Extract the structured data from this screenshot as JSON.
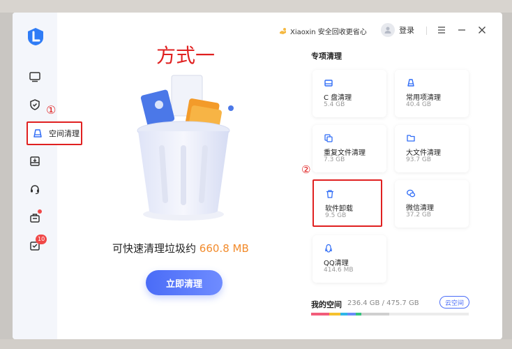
{
  "promo": {
    "text": "Xiaoxin 安全回收更省心"
  },
  "user": {
    "login": "登录"
  },
  "sidebar": {
    "active_label": "空间清理",
    "badge_count": "10"
  },
  "annotations": {
    "method_title": "方式一",
    "mark_one": "①",
    "mark_two": "②"
  },
  "main": {
    "summary_prefix": "可快速清理垃圾约",
    "summary_amount": "660.8 MB",
    "cta_label": "立即清理"
  },
  "special": {
    "title": "专项清理",
    "cards": [
      {
        "name": "C 盘清理",
        "size": "5.4 GB",
        "icon": "drive-icon"
      },
      {
        "name": "常用项清理",
        "size": "40.4 GB",
        "icon": "broom-icon"
      },
      {
        "name": "重复文件清理",
        "size": "7.3 GB",
        "icon": "duplicate-files-icon"
      },
      {
        "name": "大文件清理",
        "size": "93.7 GB",
        "icon": "folder-icon"
      },
      {
        "name": "软件卸载",
        "size": "9.5 GB",
        "icon": "trash-icon"
      },
      {
        "name": "微信清理",
        "size": "37.2 GB",
        "icon": "wechat-icon"
      },
      {
        "name": "QQ清理",
        "size": "414.6 MB",
        "icon": "qq-penguin-icon"
      }
    ]
  },
  "space": {
    "label": "我的空间",
    "value": "236.4 GB / 475.7 GB",
    "cloud_button": "云空间",
    "used_fraction": 0.497
  },
  "colors": {
    "accent": "#4a6cf7",
    "annotation_red": "#e02020",
    "amount_orange": "#f28b2c"
  }
}
